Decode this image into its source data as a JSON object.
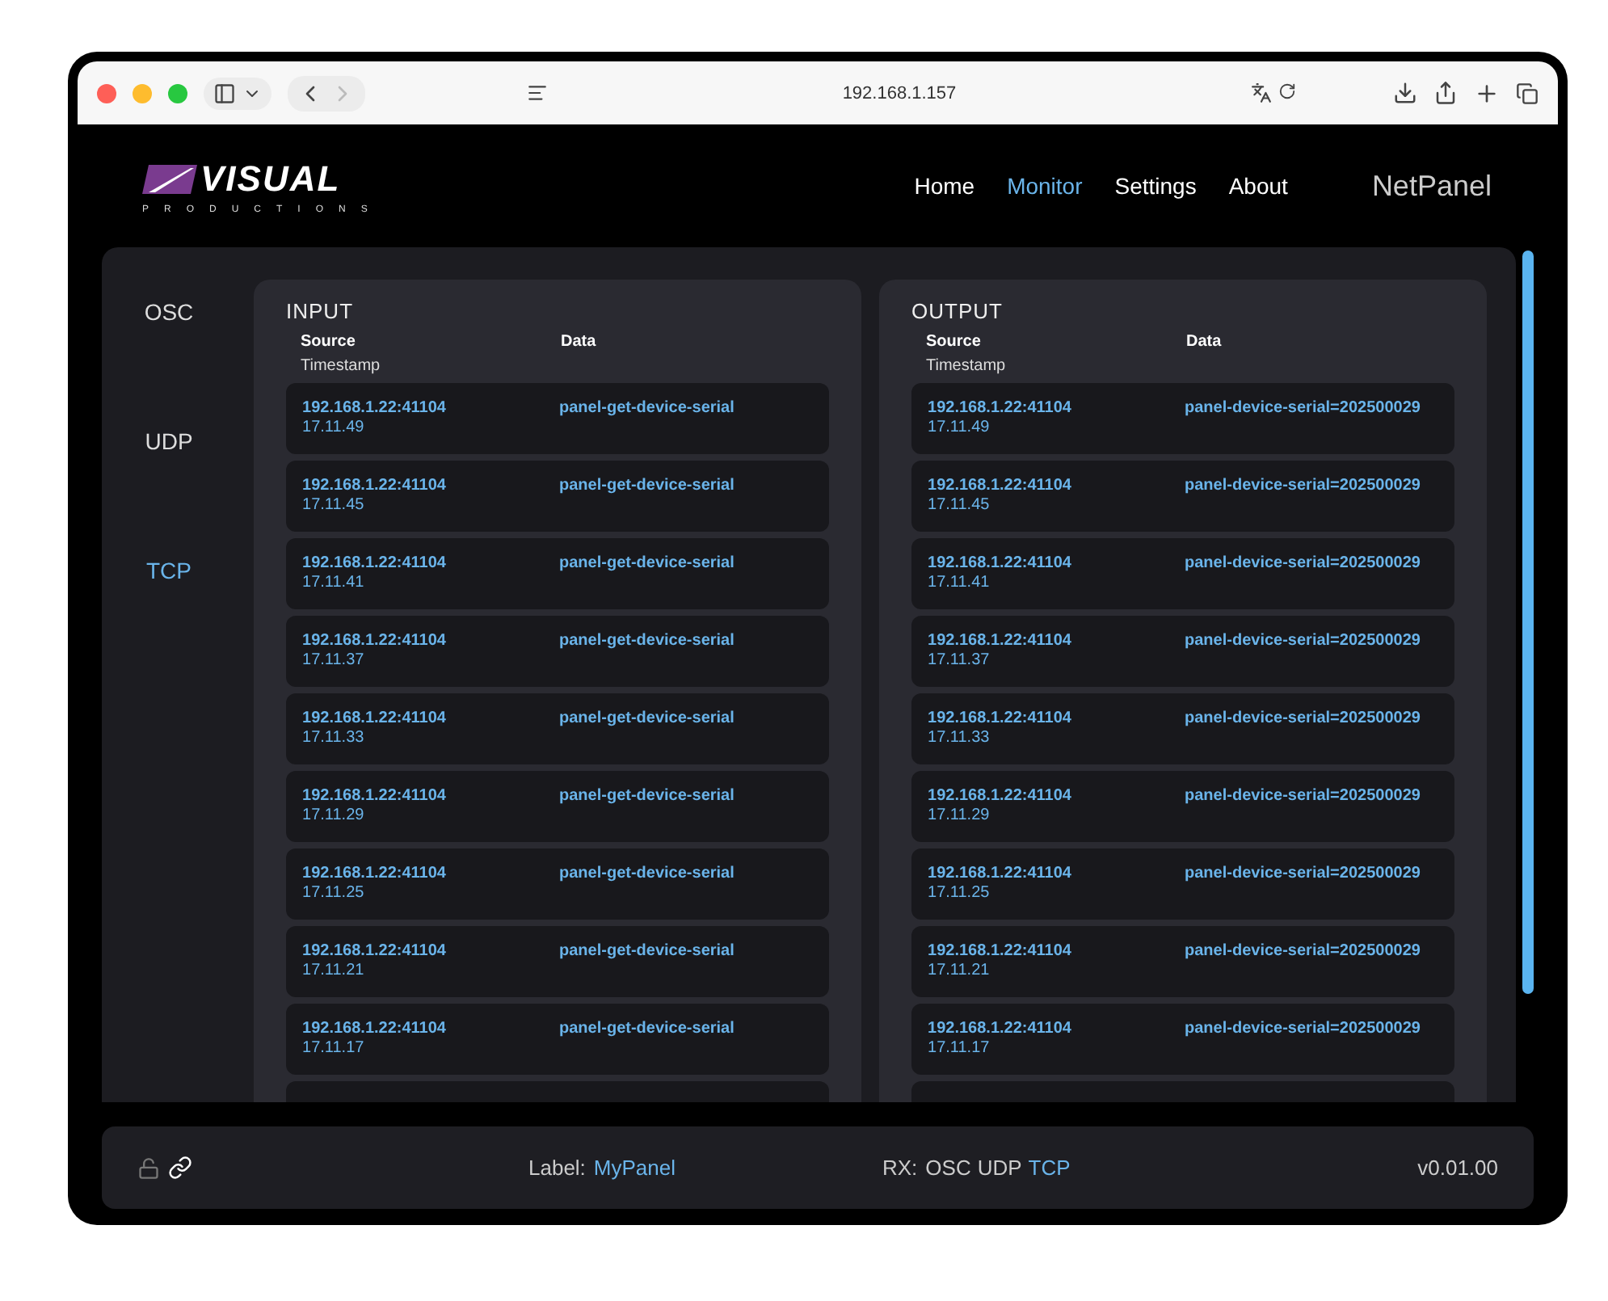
{
  "browser": {
    "url": "192.168.1.157"
  },
  "logo": {
    "name": "VISUAL",
    "tagline": "PRODUCTIONS"
  },
  "nav": [
    {
      "label": "Home",
      "selected": false
    },
    {
      "label": "Monitor",
      "selected": true
    },
    {
      "label": "Settings",
      "selected": false
    },
    {
      "label": "About",
      "selected": false
    }
  ],
  "app_title": "NetPanel",
  "sidebar": [
    {
      "label": "OSC",
      "selected": false
    },
    {
      "label": "UDP",
      "selected": false
    },
    {
      "label": "TCP",
      "selected": true
    }
  ],
  "panels": [
    {
      "title": "INPUT",
      "columns": [
        "Source",
        "Data"
      ],
      "subcolumn": "Timestamp",
      "rows": [
        {
          "source": "192.168.1.22:41104",
          "timestamp": "17.11.49",
          "data": "panel-get-device-serial"
        },
        {
          "source": "192.168.1.22:41104",
          "timestamp": "17.11.45",
          "data": "panel-get-device-serial"
        },
        {
          "source": "192.168.1.22:41104",
          "timestamp": "17.11.41",
          "data": "panel-get-device-serial"
        },
        {
          "source": "192.168.1.22:41104",
          "timestamp": "17.11.37",
          "data": "panel-get-device-serial"
        },
        {
          "source": "192.168.1.22:41104",
          "timestamp": "17.11.33",
          "data": "panel-get-device-serial"
        },
        {
          "source": "192.168.1.22:41104",
          "timestamp": "17.11.29",
          "data": "panel-get-device-serial"
        },
        {
          "source": "192.168.1.22:41104",
          "timestamp": "17.11.25",
          "data": "panel-get-device-serial"
        },
        {
          "source": "192.168.1.22:41104",
          "timestamp": "17.11.21",
          "data": "panel-get-device-serial"
        },
        {
          "source": "192.168.1.22:41104",
          "timestamp": "17.11.17",
          "data": "panel-get-device-serial"
        }
      ]
    },
    {
      "title": "OUTPUT",
      "columns": [
        "Source",
        "Data"
      ],
      "subcolumn": "Timestamp",
      "rows": [
        {
          "source": "192.168.1.22:41104",
          "timestamp": "17.11.49",
          "data": "panel-device-serial=202500029"
        },
        {
          "source": "192.168.1.22:41104",
          "timestamp": "17.11.45",
          "data": "panel-device-serial=202500029"
        },
        {
          "source": "192.168.1.22:41104",
          "timestamp": "17.11.41",
          "data": "panel-device-serial=202500029"
        },
        {
          "source": "192.168.1.22:41104",
          "timestamp": "17.11.37",
          "data": "panel-device-serial=202500029"
        },
        {
          "source": "192.168.1.22:41104",
          "timestamp": "17.11.33",
          "data": "panel-device-serial=202500029"
        },
        {
          "source": "192.168.1.22:41104",
          "timestamp": "17.11.29",
          "data": "panel-device-serial=202500029"
        },
        {
          "source": "192.168.1.22:41104",
          "timestamp": "17.11.25",
          "data": "panel-device-serial=202500029"
        },
        {
          "source": "192.168.1.22:41104",
          "timestamp": "17.11.21",
          "data": "panel-device-serial=202500029"
        },
        {
          "source": "192.168.1.22:41104",
          "timestamp": "17.11.17",
          "data": "panel-device-serial=202500029"
        }
      ]
    }
  ],
  "footer": {
    "label_caption": "Label:",
    "label_value": "MyPanel",
    "rx_caption": "RX:",
    "rx": [
      {
        "label": "OSC",
        "selected": false
      },
      {
        "label": "UDP",
        "selected": false
      },
      {
        "label": "TCP",
        "selected": true
      }
    ],
    "version": "v0.01.00"
  }
}
